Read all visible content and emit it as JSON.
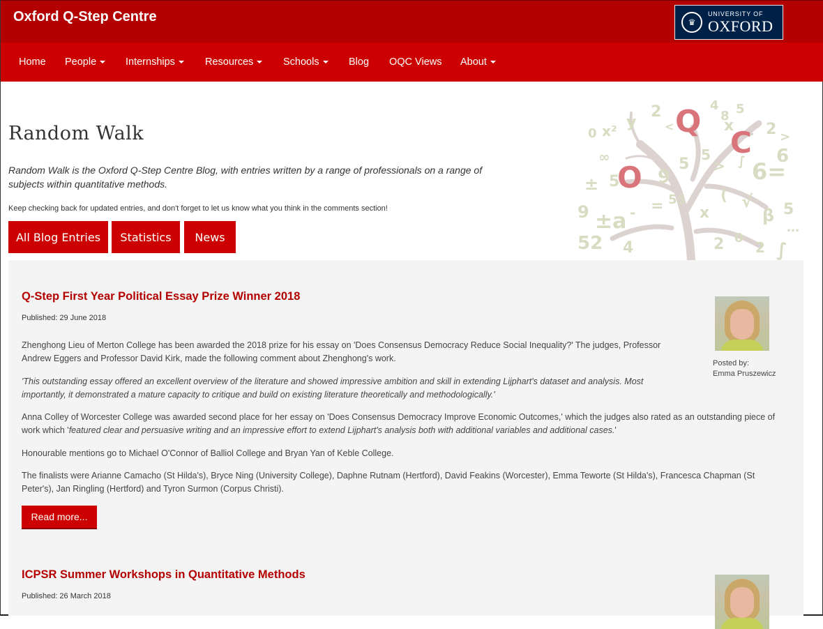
{
  "header": {
    "site_title": "Oxford Q-Step Centre",
    "logo_top": "UNIVERSITY OF",
    "logo_main": "OXFORD"
  },
  "nav": {
    "items": [
      {
        "label": "Home"
      },
      {
        "label": "People"
      },
      {
        "label": "Internships"
      },
      {
        "label": "Resources"
      },
      {
        "label": "Schools"
      },
      {
        "label": "Blog"
      },
      {
        "label": "OQC Views"
      },
      {
        "label": "About"
      }
    ]
  },
  "intro": {
    "heading": "Random Walk",
    "description": "Random Walk is the Oxford Q-Step Centre Blog, with entries written by a range of professionals on a range of subjects within quantitative methods.",
    "note": "Keep checking back for updated entries, and don't forget to let us know what you think in the comments section!",
    "buttons": [
      "All Blog Entries",
      "Statistics",
      "News"
    ]
  },
  "posts": [
    {
      "title": "Q-Step First Year Political Essay Prize Winner 2018",
      "published": "Published: 29 June 2018",
      "paragraphs": [
        "Zhenghong Lieu of Merton College has been awarded the 2018 prize for his essay on 'Does Consensus Democracy Reduce Social Inequality?'  The judges, Professor Andrew Eggers and Professor David Kirk, made the following comment about Zhenghong's work.",
        "'This outstanding essay offered an excellent overview of the literature and showed impressive ambition and skill in extending Lijphart's dataset and analysis. Most importantly, it demonstrated a mature capacity to critique and build on existing literature theoretically and methodologically.'",
        "Honourable mentions go to Michael O'Connor of Balliol College and Bryan Yan of Keble College.",
        "The finalists were Arianne Camacho (St Hilda's), Bryce Ning (University College), Daphne Rutnam (Hertford), David Feakins (Worcester), Emma Teworte (St Hilda's),  Francesca Chapman (St Peter's), Jan Ringling (Hertford) and Tyron Surmon (Corpus Christi)."
      ],
      "para3_plain": "Anna Colley of Worcester College was awarded second place for her essay on 'Does Consensus Democracy Improve Economic Outcomes,' which the judges also rated as an outstanding piece of work which '",
      "para3_em": "featured clear and persuasive writing and an impressive effort to extend Lijphart's analysis both with additional variables and additional cases.",
      "para3_end": "'",
      "read_more": "Read more...",
      "posted_by_label": "Posted by:",
      "author": "Emma Pruszewicz"
    },
    {
      "title": "ICPSR Summer Workshops in Quantitative Methods",
      "published": "Published: 26 March 2018"
    }
  ],
  "colors": {
    "header_red": "#b30000",
    "nav_red": "#cc0000",
    "title_red": "#b30000",
    "content_bg": "#f4f4f4"
  }
}
